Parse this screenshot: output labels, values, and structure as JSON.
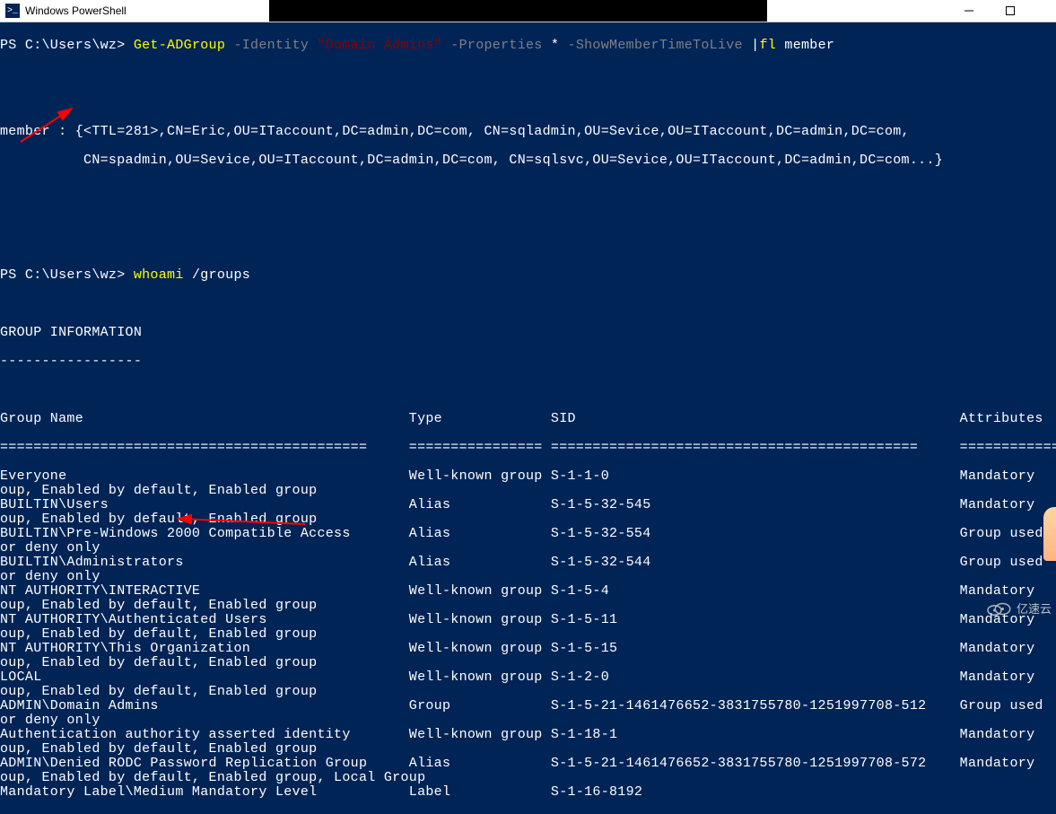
{
  "window": {
    "title": "Windows PowerShell",
    "icon_glyph": ">_"
  },
  "cmd1": {
    "prompt": "PS C:\\Users\\wz> ",
    "cmdlet": "Get-ADGroup ",
    "param1": "-Identity ",
    "value1": "\"Domain Admins\" ",
    "param2": "-Properties ",
    "value2": "* ",
    "param3": "-ShowMemberTimeToLive ",
    "pipe": "|",
    "cmdlet2": "fl ",
    "arg": "member"
  },
  "output1": {
    "line1": "member : {<TTL=281>,CN=Eric,OU=ITaccount,DC=admin,DC=com, CN=sqladmin,OU=Sevice,OU=ITaccount,DC=admin,DC=com,",
    "line2": "          CN=spadmin,OU=Sevice,OU=ITaccount,DC=admin,DC=com, CN=sqlsvc,OU=Sevice,OU=ITaccount,DC=admin,DC=com...}"
  },
  "cmd2": {
    "prompt": "PS C:\\Users\\wz> ",
    "cmdlet": "whoami ",
    "arg": "/groups"
  },
  "output2": {
    "header": "GROUP INFORMATION",
    "dashes": "-----------------",
    "col_name": "Group Name",
    "col_type": "Type",
    "col_sid": "SID",
    "col_attr": "Attributes",
    "sep1": "============================================",
    "sep2": "================",
    "sep3": "============================================",
    "sep4": "===========================================================",
    "rows": [
      {
        "n": "Everyone",
        "t": "Well-known group",
        "s": "S-1-1-0",
        "a": "Mandatory "
      },
      {
        "n": "oup, Enabled by default, Enabled group",
        "t": "",
        "s": "",
        "a": ""
      },
      {
        "n": "BUILTIN\\Users",
        "t": "Alias",
        "s": "S-1-5-32-545",
        "a": "Mandatory "
      },
      {
        "n": "oup, Enabled by default, Enabled group",
        "t": "",
        "s": "",
        "a": ""
      },
      {
        "n": "BUILTIN\\Pre-Windows 2000 Compatible Access",
        "t": "Alias",
        "s": "S-1-5-32-554",
        "a": "Group used"
      },
      {
        "n": "or deny only",
        "t": "",
        "s": "",
        "a": ""
      },
      {
        "n": "BUILTIN\\Administrators",
        "t": "Alias",
        "s": "S-1-5-32-544",
        "a": "Group used"
      },
      {
        "n": "or deny only",
        "t": "",
        "s": "",
        "a": ""
      },
      {
        "n": "NT AUTHORITY\\INTERACTIVE",
        "t": "Well-known group",
        "s": "S-1-5-4",
        "a": "Mandatory "
      },
      {
        "n": "oup, Enabled by default, Enabled group",
        "t": "",
        "s": "",
        "a": ""
      },
      {
        "n": "NT AUTHORITY\\Authenticated Users",
        "t": "Well-known group",
        "s": "S-1-5-11",
        "a": "Mandatory "
      },
      {
        "n": "oup, Enabled by default, Enabled group",
        "t": "",
        "s": "",
        "a": ""
      },
      {
        "n": "NT AUTHORITY\\This Organization",
        "t": "Well-known group",
        "s": "S-1-5-15",
        "a": "Mandatory "
      },
      {
        "n": "oup, Enabled by default, Enabled group",
        "t": "",
        "s": "",
        "a": ""
      },
      {
        "n": "LOCAL",
        "t": "Well-known group",
        "s": "S-1-2-0",
        "a": "Mandatory "
      },
      {
        "n": "oup, Enabled by default, Enabled group",
        "t": "",
        "s": "",
        "a": ""
      },
      {
        "n": "ADMIN\\Domain Admins",
        "t": "Group",
        "s": "S-1-5-21-1461476652-3831755780-1251997708-512",
        "a": "Group used"
      },
      {
        "n": "or deny only",
        "t": "",
        "s": "",
        "a": ""
      },
      {
        "n": "Authentication authority asserted identity",
        "t": "Well-known group",
        "s": "S-1-18-1",
        "a": "Mandatory "
      },
      {
        "n": "oup, Enabled by default, Enabled group",
        "t": "",
        "s": "",
        "a": ""
      },
      {
        "n": "ADMIN\\Denied RODC Password Replication Group",
        "t": "Alias",
        "s": "S-1-5-21-1461476652-3831755780-1251997708-572",
        "a": "Mandatory "
      },
      {
        "n": "oup, Enabled by default, Enabled group, Local Group",
        "t": "",
        "s": "",
        "a": ""
      },
      {
        "n": "Mandatory Label\\Medium Mandatory Level",
        "t": "Label",
        "s": "S-1-16-8192",
        "a": ""
      }
    ]
  },
  "watermark": "亿速云"
}
